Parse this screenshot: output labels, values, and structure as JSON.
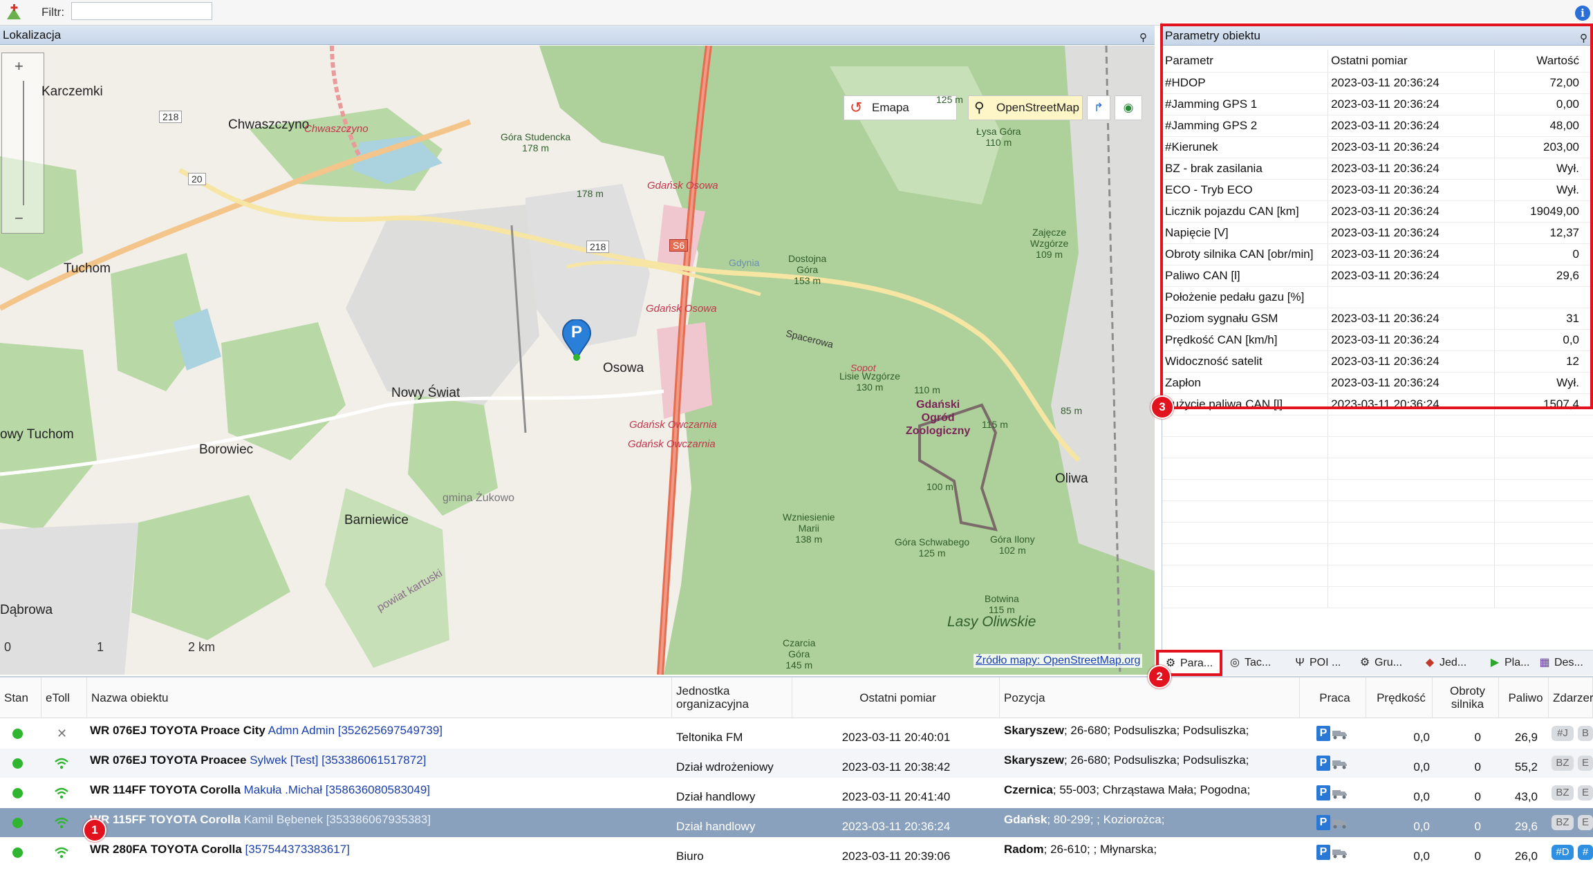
{
  "toolbar": {
    "filter_label": "Filtr:",
    "filter_value": ""
  },
  "map_panel": {
    "title": "Lokalizacja",
    "buttons": {
      "emapa": "Emapa",
      "osm": "OpenStreetMap"
    },
    "attribution": "Źródło mapy: OpenStreetMap.org",
    "scale": {
      "zero": "0",
      "one": "1",
      "two": "2 km"
    },
    "pin_label": "P",
    "labels": {
      "karczemki": "Karczemki",
      "chwaszczyno": "Chwaszczyno",
      "chwaszczyno_st": "Chwaszczyno",
      "tuchom": "Tuchom",
      "nowy_tuchom": "owy Tuchom",
      "borowiec": "Borowiec",
      "nowy_swiat": "Nowy Świat",
      "osowa": "Osowa",
      "barniewice": "Barniewice",
      "dabrowa": "Dąbrowa",
      "oliwa": "Oliwa",
      "lasy": "Lasy Oliwskie",
      "gmina": "gmina Żukowo",
      "kartuski": "powiat kartuski",
      "gdansk_osowa1": "Gdańsk Osowa",
      "gdansk_osowa2": "Gdańsk Osowa",
      "owczarnia1": "Gdańsk Owczarnia",
      "owczarnia2": "Gdańsk Owczarnia",
      "zoo": "Gdański\nOgród\nZoologiczny",
      "gora_studencka": "Góra Studencka\n178 m",
      "dostojna": "Dostojna\nGóra\n153 m",
      "lisie": "Lisie Wzgórze\n130 m",
      "zajecze": "Zajęcze\nWzgórze\n109 m",
      "lysa": "Łysa Góra\n110 m",
      "wznies": "Wzniesienie\nMarii\n138 m",
      "schwabego": "Góra Schwabego\n125 m",
      "ilony": "Góra Ilony\n102 m",
      "botwina": "Botwina\n115 m",
      "czarcia": "Czarcia\nGóra\n145 m",
      "road_218a": "218",
      "road_218b": "218",
      "road_20": "20",
      "road_s6": "S6",
      "sopot": "Sopot",
      "spacerowa": "Spacerowa",
      "gdynia": "Gdynia",
      "m178": "178 m",
      "m125": "125 m",
      "m115": "115 m",
      "m100": "100 m",
      "m85": "85 m",
      "m110": "110 m"
    }
  },
  "param_panel": {
    "title": "Parametry obiektu",
    "columns": [
      "Parametr",
      "Ostatni pomiar",
      "Wartość"
    ],
    "rows": [
      [
        "#HDOP",
        "2023-03-11 20:36:24",
        "72,00"
      ],
      [
        "#Jamming GPS 1",
        "2023-03-11 20:36:24",
        "0,00"
      ],
      [
        "#Jamming GPS 2",
        "2023-03-11 20:36:24",
        "48,00"
      ],
      [
        "#Kierunek",
        "2023-03-11 20:36:24",
        "203,00"
      ],
      [
        "BZ - brak zasilania",
        "2023-03-11 20:36:24",
        "Wył."
      ],
      [
        "ECO - Tryb ECO",
        "2023-03-11 20:36:24",
        "Wył."
      ],
      [
        "Licznik pojazdu CAN [km]",
        "2023-03-11 20:36:24",
        "19049,00"
      ],
      [
        "Napięcie [V]",
        "2023-03-11 20:36:24",
        "12,37"
      ],
      [
        "Obroty silnika CAN [obr/min]",
        "2023-03-11 20:36:24",
        "0"
      ],
      [
        "Paliwo CAN [l]",
        "2023-03-11 20:36:24",
        "29,6"
      ],
      [
        "Położenie pedału gazu [%]",
        "",
        ""
      ],
      [
        "Poziom sygnału GSM",
        "2023-03-11 20:36:24",
        "31"
      ],
      [
        "Prędkość CAN [km/h]",
        "2023-03-11 20:36:24",
        "0,0"
      ],
      [
        "Widoczność satelit",
        "2023-03-11 20:36:24",
        "12"
      ],
      [
        "Zapłon",
        "2023-03-11 20:36:24",
        "Wył."
      ],
      [
        "Zużycie paliwa CAN [l]",
        "2023-03-11 20:36:24",
        "1507,4"
      ]
    ]
  },
  "tabs": [
    "Para...",
    "Tac...",
    "POI ...",
    "Gru...",
    "Jed...",
    "Pla...",
    "Des..."
  ],
  "markers": {
    "m1": "1",
    "m2": "2",
    "m3": "3"
  },
  "vehicles": {
    "columns": {
      "stan": "Stan",
      "etoll": "eToll",
      "nazwa": "Nazwa obiektu",
      "jednostka": "Jednostka organizacyjna",
      "pomiar": "Ostatni pomiar",
      "pozycja": "Pozycja",
      "praca": "Praca",
      "predkosc": "Prędkość",
      "obroty": "Obroty silnika",
      "paliwo": "Paliwo",
      "zdarzenia": "Zdarzer"
    },
    "rows": [
      {
        "plate": "WR 076EJ",
        "model": "TOYOTA Proace City",
        "driver": "Admn Admin [352625697549739]",
        "unit": "Teltonika FM",
        "time": "2023-03-11 20:40:01",
        "city": "Skaryszew",
        "addr": "; 26-680; Podsuliszka; Podsuliszka;",
        "speed": "0,0",
        "rpm": "0",
        "fuel": "26,9",
        "ev1": "#J",
        "ev2": "B"
      },
      {
        "plate": "WR 076EJ",
        "model": "TOYOTA Proacee",
        "driver": "Sylwek [Test] [353386061517872]",
        "unit": "Dział wdrożeniowy",
        "time": "2023-03-11 20:38:42",
        "city": "Skaryszew",
        "addr": "; 26-680; Podsuliszka; Podsuliszka;",
        "speed": "0,0",
        "rpm": "0",
        "fuel": "55,2",
        "ev1": "BZ",
        "ev2": "E"
      },
      {
        "plate": "WR 114FF",
        "model": "TOYOTA Corolla",
        "driver": "Makuła .Michał [358636080583049]",
        "unit": "Dział handlowy",
        "time": "2023-03-11 20:41:40",
        "city": "Czernica",
        "addr": "; 55-003; Chrząstawa Mała; Pogodna;",
        "speed": "0,0",
        "rpm": "0",
        "fuel": "43,0",
        "ev1": "BZ",
        "ev2": "E"
      },
      {
        "plate": "WR 115FF",
        "model": "TOYOTA Corolla",
        "driver": "Kamil Bębenek [353386067935383]",
        "unit": "Dział handlowy",
        "time": "2023-03-11 20:36:24",
        "city": "Gdańsk",
        "addr": "; 80-299; ; Koziorożca;",
        "speed": "0,0",
        "rpm": "0",
        "fuel": "29,6",
        "ev1": "BZ",
        "ev2": "E"
      },
      {
        "plate": "WR 280FA",
        "model": "TOYOTA Corolla",
        "driver": "[357544373383617]",
        "unit": "Biuro",
        "time": "2023-03-11 20:39:06",
        "city": "Radom",
        "addr": "; 26-610; ; Młynarska;",
        "speed": "0,0",
        "rpm": "0",
        "fuel": "26,0",
        "ev1": "#D",
        "ev2": "#"
      }
    ]
  }
}
